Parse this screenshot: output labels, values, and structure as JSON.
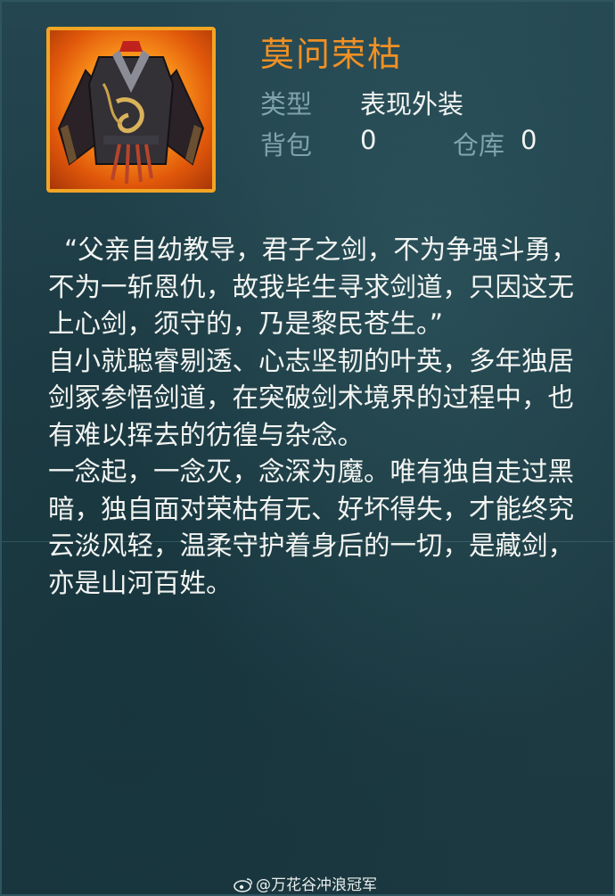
{
  "item": {
    "name": "莫问荣枯",
    "icon": "outfit-robe-icon",
    "type_label": "类型",
    "type_value": "表现外装",
    "bag_label": "背包",
    "bag_count": "0",
    "warehouse_label": "仓库",
    "warehouse_count": "0"
  },
  "description": {
    "paragraphs": [
      "“父亲自幼教导，君子之剑，不为争强斗勇，不为一斩恩仇，故我毕生寻求剑道，只因这无上心剑，须守的，乃是黎民苍生。”",
      "自小就聪睿剔透、心志坚韧的叶英，多年独居剑冢参悟剑道，在突破剑术境界的过程中，也有难以挥去的彷徨与杂念。",
      "一念起，一念灭，念深为魔。唯有独自走过黑暗，独自面对荣枯有无、好坏得失，才能终究云淡风轻，温柔守护着身后的一切，是藏剑，亦是山河百姓。"
    ]
  },
  "watermark": {
    "icon": "weibo-icon",
    "text": "@万花谷冲浪冠军"
  },
  "colors": {
    "background": "#1f3d46",
    "title": "#f19024",
    "label": "#7fa3aa",
    "text": "#f3f5f2",
    "icon_border": "#f2a524"
  }
}
